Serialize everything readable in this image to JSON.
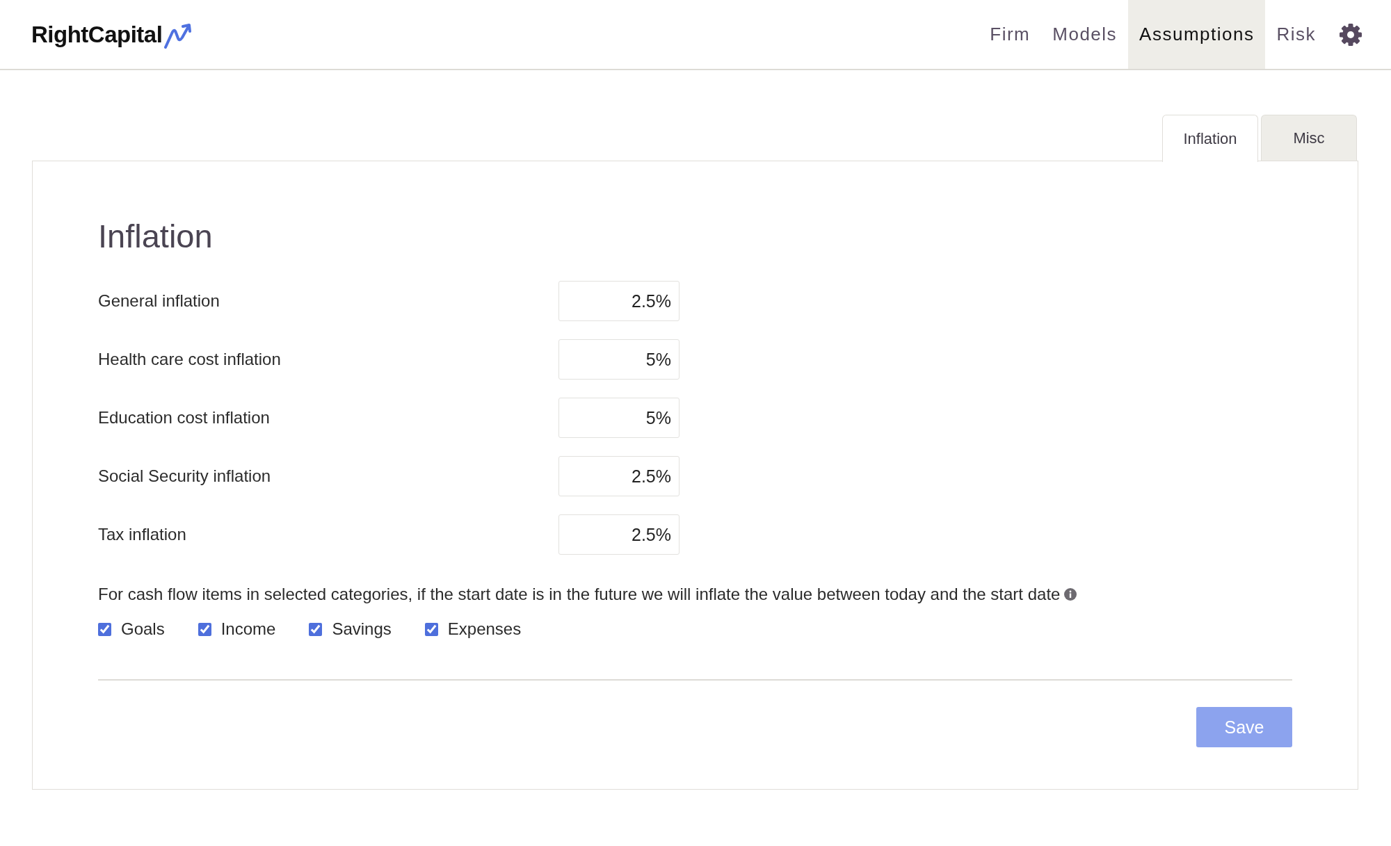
{
  "header": {
    "logo": "RightCapital",
    "nav": [
      {
        "label": "Firm",
        "selected": false
      },
      {
        "label": "Models",
        "selected": false
      },
      {
        "label": "Assumptions",
        "selected": true
      },
      {
        "label": "Risk",
        "selected": false
      }
    ]
  },
  "tabs": [
    {
      "label": "Inflation",
      "selected": true
    },
    {
      "label": "Misc",
      "selected": false
    }
  ],
  "panel": {
    "title": "Inflation",
    "fields": [
      {
        "label": "General inflation",
        "value": "2.5%"
      },
      {
        "label": "Health care cost inflation",
        "value": "5%"
      },
      {
        "label": "Education cost inflation",
        "value": "5%"
      },
      {
        "label": "Social Security inflation",
        "value": "2.5%"
      },
      {
        "label": "Tax inflation",
        "value": "2.5%"
      }
    ],
    "note": "For cash flow items in selected categories, if the start date is in the future we will inflate the value between today and the start date",
    "categories": [
      {
        "label": "Goals",
        "checked": true
      },
      {
        "label": "Income",
        "checked": true
      },
      {
        "label": "Savings",
        "checked": true
      },
      {
        "label": "Expenses",
        "checked": true
      }
    ],
    "save_button": {
      "label": "Save",
      "disabled": true
    }
  }
}
